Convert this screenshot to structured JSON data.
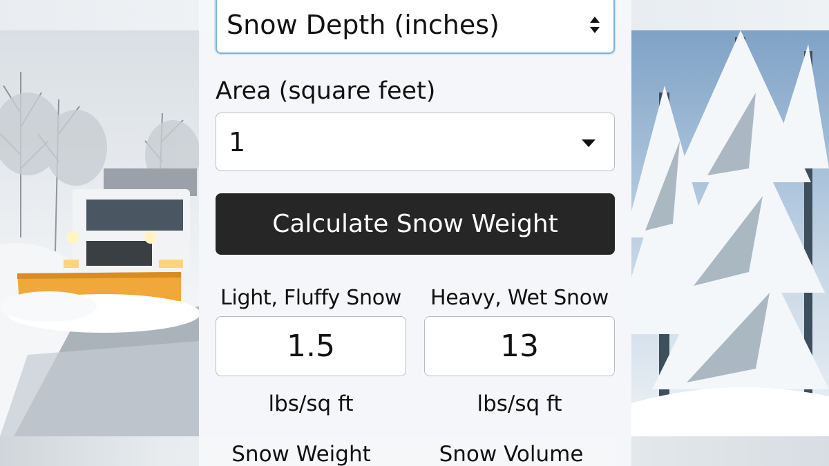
{
  "depth_select": {
    "value": "Snow Depth (inches)",
    "icon": "up-down-arrows-icon"
  },
  "area": {
    "label": "Area (square feet)",
    "value": "1",
    "icon": "caret-down-icon"
  },
  "calculate_button": {
    "label": "Calculate Snow Weight"
  },
  "results": {
    "light": {
      "title": "Light, Fluffy Snow",
      "value": "1.5",
      "unit": "lbs/sq ft"
    },
    "heavy": {
      "title": "Heavy, Wet Snow",
      "value": "13",
      "unit": "lbs/sq ft"
    }
  },
  "footer": {
    "snow_weight_label": "Snow Weight",
    "snow_volume_label": "Snow Volume"
  },
  "colors": {
    "button_bg": "#262626",
    "focus_border": "#7fb2d9",
    "panel_bg": "#f6f7f9"
  }
}
